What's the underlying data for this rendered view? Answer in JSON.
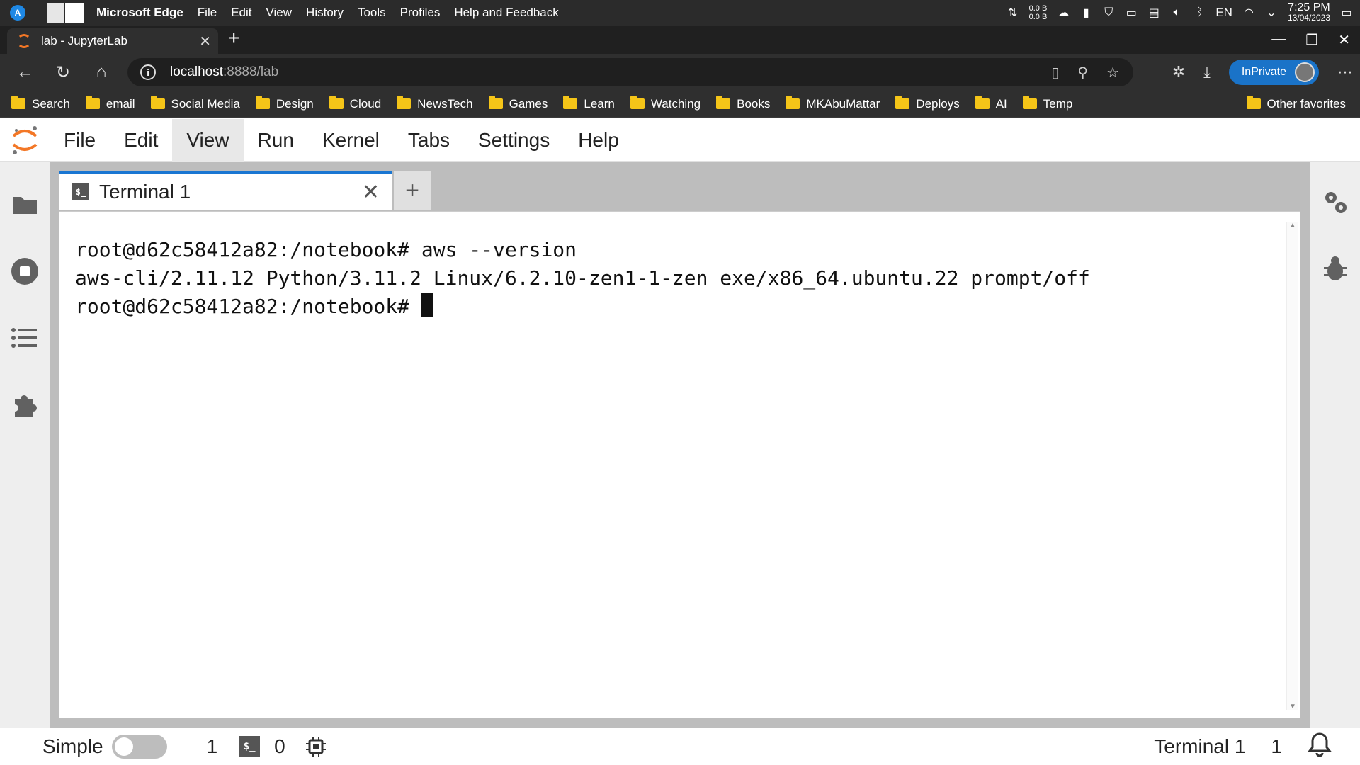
{
  "os": {
    "app_name": "Microsoft Edge",
    "menu": [
      "File",
      "Edit",
      "View",
      "History",
      "Tools",
      "Profiles",
      "Help and Feedback"
    ],
    "net_down": "0.0 B",
    "net_up": "0.0 B",
    "lang": "EN",
    "time": "7:25 PM",
    "date": "13/04/2023"
  },
  "browser": {
    "tab_title": "lab - JupyterLab",
    "url_host": "localhost",
    "url_path": ":8888/lab",
    "inprivate_label": "InPrivate",
    "favorites": [
      "Search",
      "email",
      "Social Media",
      "Design",
      "Cloud",
      "NewsTech",
      "Games",
      "Learn",
      "Watching",
      "Books",
      "MKAbuMattar",
      "Deploys",
      "AI",
      "Temp"
    ],
    "other_favorites": "Other favorites"
  },
  "jupyter": {
    "menu": [
      "File",
      "Edit",
      "View",
      "Run",
      "Kernel",
      "Tabs",
      "Settings",
      "Help"
    ],
    "active_menu": "View",
    "tab_label": "Terminal 1",
    "terminal_icon_text": "$_",
    "terminal_lines": [
      "root@d62c58412a82:/notebook# aws --version",
      "aws-cli/2.11.12 Python/3.11.2 Linux/6.2.10-zen1-1-zen exe/x86_64.ubuntu.22 prompt/off",
      "root@d62c58412a82:/notebook# "
    ],
    "status": {
      "simple_label": "Simple",
      "simple_on": false,
      "terminals_count": "1",
      "kernels_count": "0",
      "current_activity": "Terminal 1",
      "notifications_count": "1"
    }
  }
}
